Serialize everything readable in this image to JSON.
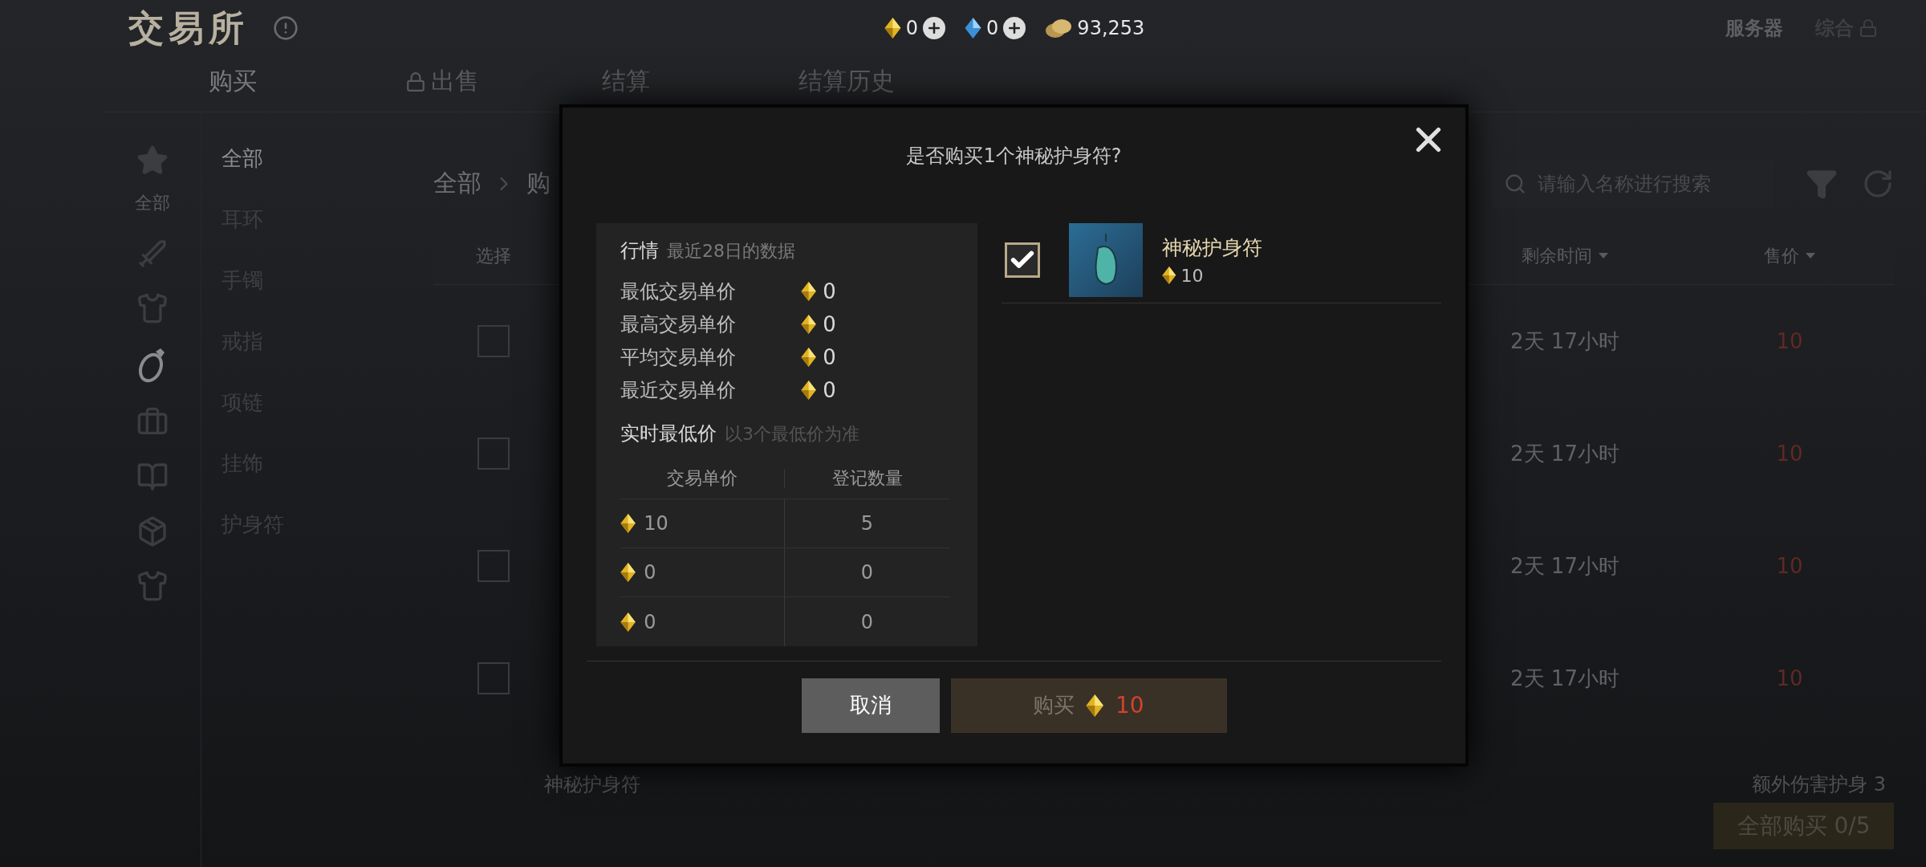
{
  "header": {
    "title": "交易所",
    "currencies": [
      {
        "kind": "gold",
        "amount": "0",
        "add": true
      },
      {
        "kind": "blue",
        "amount": "0",
        "add": true
      },
      {
        "kind": "coin",
        "amount": "93,253",
        "add": false
      }
    ],
    "server": "服务器",
    "mode": {
      "label": "综合",
      "locked": true
    }
  },
  "tabs": [
    {
      "label": "购买",
      "selected": true,
      "locked": false
    },
    {
      "label": "出售",
      "selected": false,
      "locked": true
    },
    {
      "label": "结算",
      "selected": false,
      "locked": false
    },
    {
      "label": "结算历史",
      "selected": false,
      "locked": false
    }
  ],
  "sidebar": {
    "icons": [
      {
        "kind": "star",
        "label": "全部",
        "selected": false
      },
      {
        "kind": "sword",
        "selected": false
      },
      {
        "kind": "armor",
        "selected": false
      },
      {
        "kind": "ring",
        "selected": true
      },
      {
        "kind": "chest",
        "selected": false
      },
      {
        "kind": "book",
        "selected": false
      },
      {
        "kind": "box",
        "selected": false
      },
      {
        "kind": "robe",
        "selected": false
      }
    ]
  },
  "categories": [
    {
      "label": "全部",
      "selected": true
    },
    {
      "label": "耳环",
      "selected": false
    },
    {
      "label": "手镯",
      "selected": false
    },
    {
      "label": "戒指",
      "selected": false
    },
    {
      "label": "项链",
      "selected": false
    },
    {
      "label": "挂饰",
      "selected": false
    },
    {
      "label": "护身符",
      "selected": false
    }
  ],
  "breadcrumb": [
    "全部",
    "购"
  ],
  "search": {
    "placeholder": "请输入名称进行搜索"
  },
  "table": {
    "columns": [
      {
        "label": "选择",
        "sortable": false
      },
      {
        "label": "剩余时间",
        "sortable": true
      },
      {
        "label": "售价",
        "sortable": true
      }
    ],
    "rows": [
      {
        "checked": false,
        "remaining": "2天 17小时",
        "price": "10"
      },
      {
        "checked": false,
        "remaining": "2天 17小时",
        "price": "10"
      },
      {
        "checked": false,
        "remaining": "2天 17小时",
        "price": "10"
      },
      {
        "checked": false,
        "remaining": "2天 17小时",
        "price": "10"
      }
    ],
    "partial_row": {
      "name": "神秘护身符",
      "effect": "额外伤害护身 3"
    }
  },
  "buy_all": "全部购买 0/5",
  "dialog": {
    "title": "是否购买1个神秘护身符?",
    "market": {
      "heading": "行情",
      "note": "最近28日的数据",
      "stats": [
        {
          "label": "最低交易单价",
          "value": "0"
        },
        {
          "label": "最高交易单价",
          "value": "0"
        },
        {
          "label": "平均交易单价",
          "value": "0"
        },
        {
          "label": "最近交易单价",
          "value": "0"
        }
      ],
      "realtime_heading": "实时最低价",
      "realtime_note": "以3个最低价为准",
      "columns": [
        "交易单价",
        "登记数量"
      ],
      "rows": [
        {
          "price": "10",
          "quantity": "5"
        },
        {
          "price": "0",
          "quantity": "0"
        },
        {
          "price": "0",
          "quantity": "0"
        }
      ]
    },
    "item": {
      "checked": true,
      "name": "神秘护身符",
      "price": "10"
    },
    "cancel": "取消",
    "buy": {
      "label": "购买",
      "price": "10"
    }
  }
}
